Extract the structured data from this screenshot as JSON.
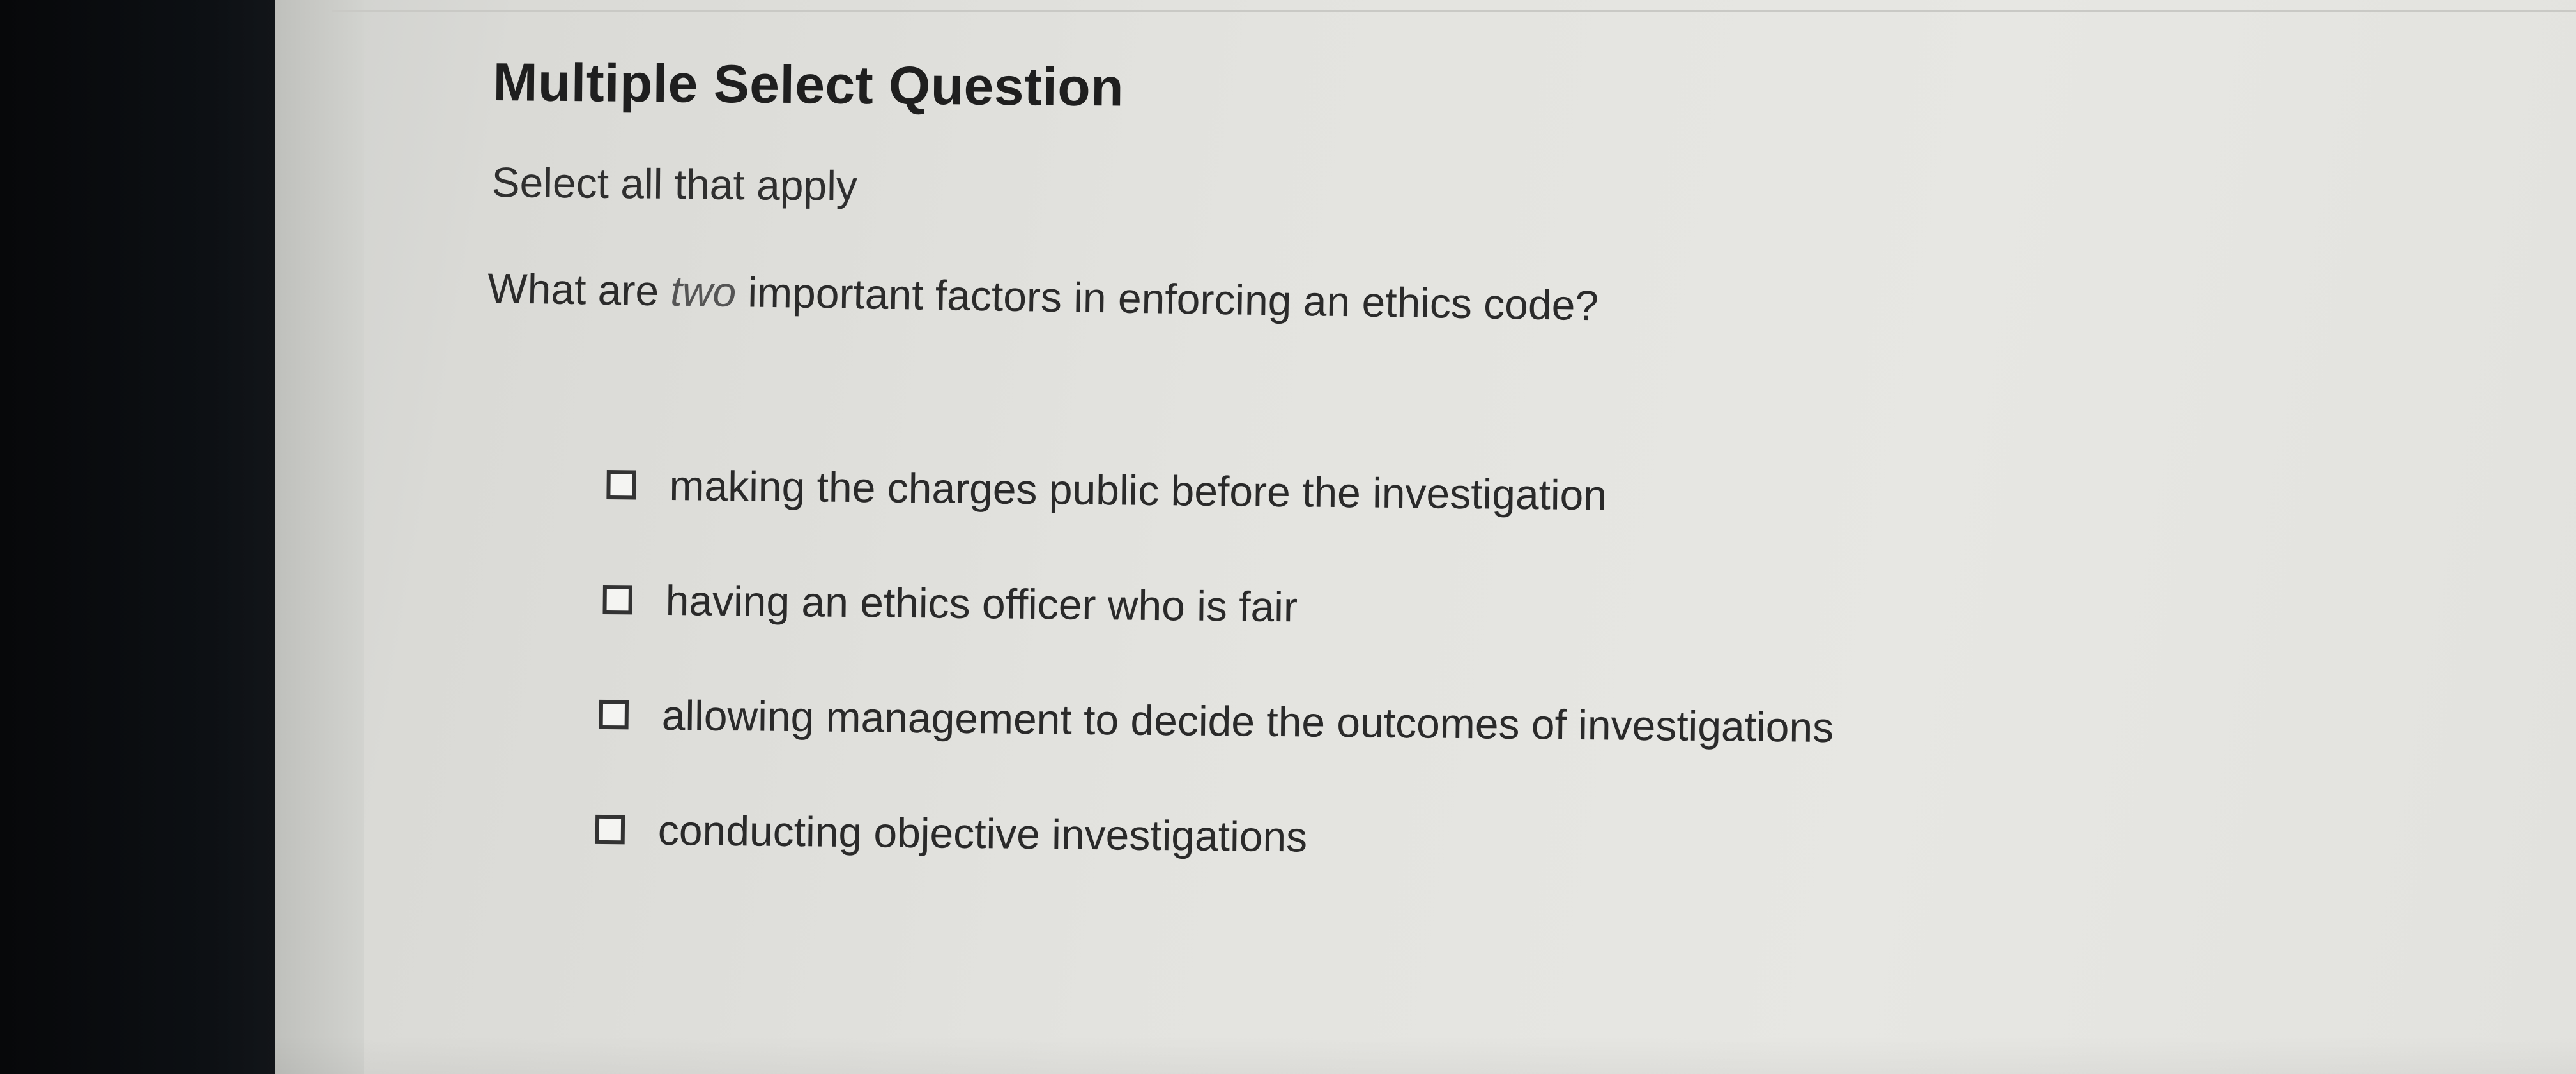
{
  "question": {
    "type_heading": "Multiple Select Question",
    "instruction": "Select all that apply",
    "prompt_before": "What are ",
    "prompt_emphasis": "two",
    "prompt_after": " important factors in enforcing an ethics code?"
  },
  "options": [
    {
      "label": "making the charges public before the investigation",
      "checked": false
    },
    {
      "label": "having an ethics officer who is fair",
      "checked": false
    },
    {
      "label": "allowing management to decide the outcomes of investigations",
      "checked": false
    },
    {
      "label": "conducting objective investigations",
      "checked": false
    }
  ],
  "icons": {
    "checkbox": "checkbox-unchecked-icon"
  }
}
